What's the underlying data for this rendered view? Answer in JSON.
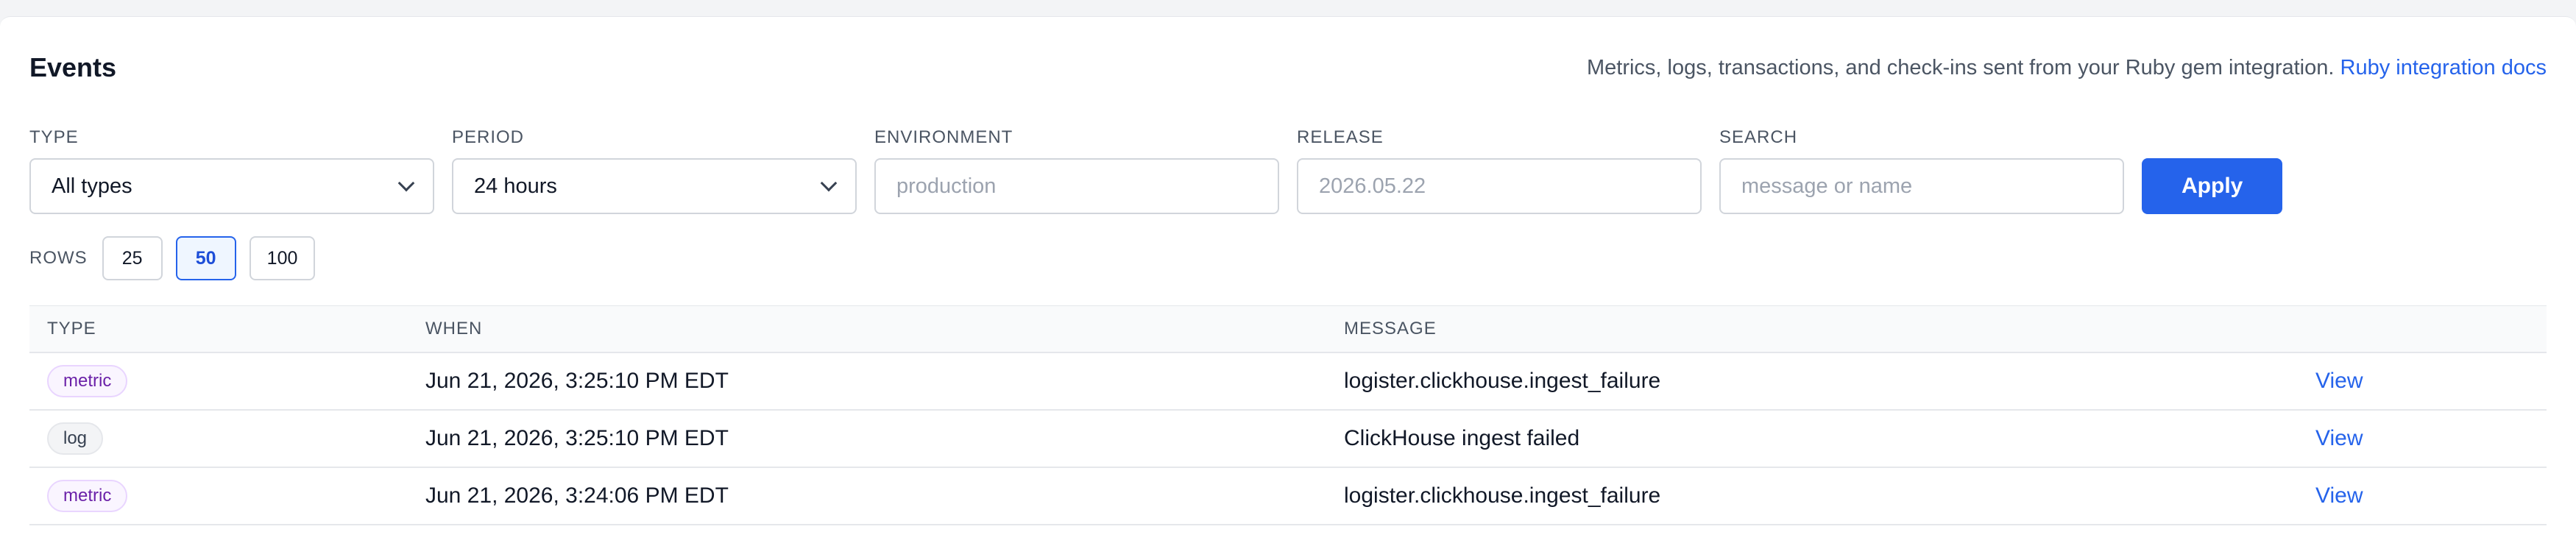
{
  "header": {
    "title": "Events",
    "description": "Metrics, logs, transactions, and check-ins sent from your Ruby gem integration.",
    "docs_link": "Ruby integration docs"
  },
  "filters": {
    "type": {
      "label": "TYPE",
      "value": "All types"
    },
    "period": {
      "label": "PERIOD",
      "value": "24 hours"
    },
    "environment": {
      "label": "ENVIRONMENT",
      "placeholder": "production"
    },
    "release": {
      "label": "RELEASE",
      "placeholder": "2026.05.22"
    },
    "search": {
      "label": "SEARCH",
      "placeholder": "message or name"
    },
    "apply_label": "Apply"
  },
  "rows": {
    "label": "ROWS",
    "options": [
      "25",
      "50",
      "100"
    ],
    "selected": "50"
  },
  "table": {
    "headers": [
      "TYPE",
      "WHEN",
      "MESSAGE",
      ""
    ],
    "rows": [
      {
        "type": "metric",
        "when": "Jun 21, 2026, 3:25:10 PM EDT",
        "message": "logister.clickhouse.ingest_failure",
        "action": "View"
      },
      {
        "type": "log",
        "when": "Jun 21, 2026, 3:25:10 PM EDT",
        "message": "ClickHouse ingest failed",
        "action": "View"
      },
      {
        "type": "metric",
        "when": "Jun 21, 2026, 3:24:06 PM EDT",
        "message": "logister.clickhouse.ingest_failure",
        "action": "View"
      }
    ]
  },
  "colors": {
    "accent": "#2563eb",
    "metric_badge": "#6b21a8",
    "log_badge": "#374151"
  }
}
